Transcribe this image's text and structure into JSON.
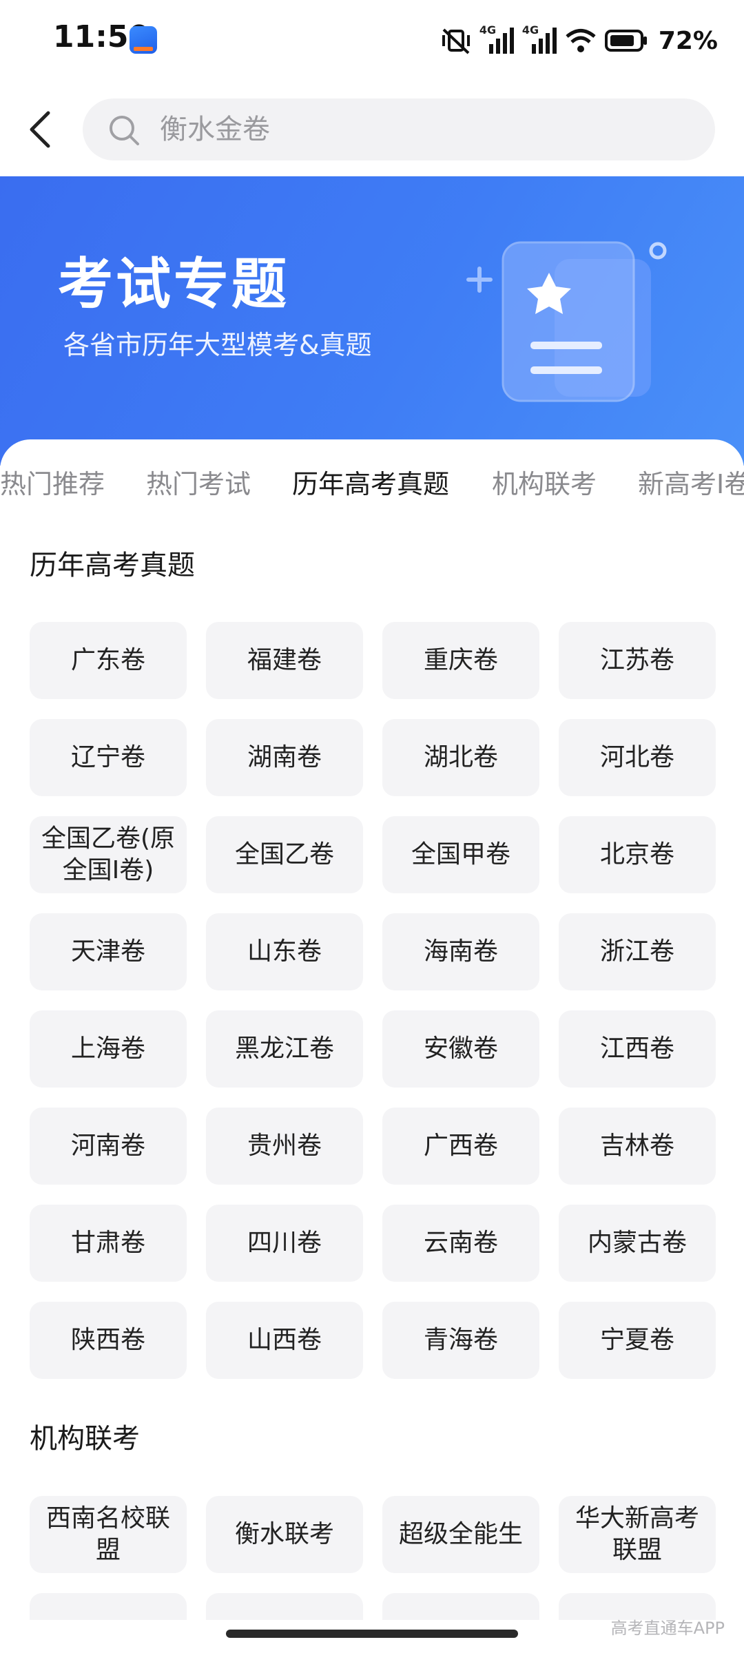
{
  "status_bar": {
    "time": "11:50",
    "network_1": "4G",
    "network_2": "4G",
    "battery": "72%"
  },
  "search": {
    "placeholder": "衡水金卷"
  },
  "banner": {
    "title": "考试专题",
    "subtitle": "各省市历年大型模考&真题"
  },
  "tabs": [
    {
      "label": "热门推荐",
      "active": false
    },
    {
      "label": "热门考试",
      "active": false
    },
    {
      "label": "历年高考真题",
      "active": true
    },
    {
      "label": "机构联考",
      "active": false
    },
    {
      "label": "新高考Ⅰ卷",
      "active": false
    }
  ],
  "sections": {
    "past_exams": {
      "title": "历年高考真题",
      "items": [
        "广东卷",
        "福建卷",
        "重庆卷",
        "江苏卷",
        "辽宁卷",
        "湖南卷",
        "湖北卷",
        "河北卷",
        "全国乙卷(原全国Ⅰ卷)",
        "全国乙卷",
        "全国甲卷",
        "北京卷",
        "天津卷",
        "山东卷",
        "海南卷",
        "浙江卷",
        "上海卷",
        "黑龙江卷",
        "安徽卷",
        "江西卷",
        "河南卷",
        "贵州卷",
        "广西卷",
        "吉林卷",
        "甘肃卷",
        "四川卷",
        "云南卷",
        "内蒙古卷",
        "陕西卷",
        "山西卷",
        "青海卷",
        "宁夏卷"
      ]
    },
    "joint_exams": {
      "title": "机构联考",
      "items": [
        "西南名校联盟",
        "衡水联考",
        "超级全能生",
        "华大新高考联盟"
      ]
    }
  },
  "watermark": "高考直通车APP",
  "colors": {
    "accent": "#3a6df0",
    "chip_bg": "#f4f4f6",
    "inactive_tab": "#8a8a8e"
  }
}
